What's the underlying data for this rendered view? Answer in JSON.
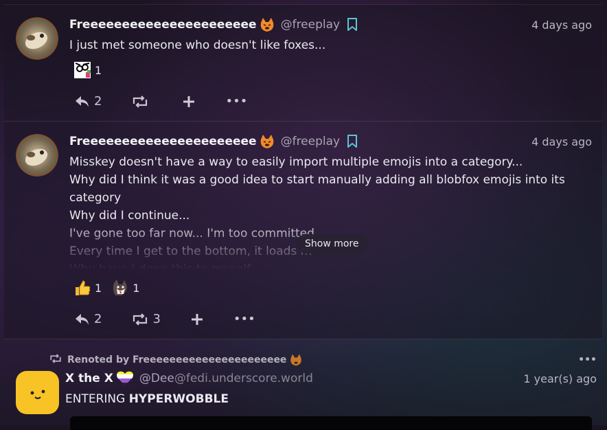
{
  "notes": [
    {
      "user": {
        "display_name": "Freeeeeeeeeeeeeeeeeeeeee",
        "name_emoji": "blobfox-angry-emoji",
        "handle": "@freeplay",
        "bookmark_icon": "bookmark-icon"
      },
      "time": "4 days ago",
      "text": [
        "I just met someone who doesn't like foxes..."
      ],
      "reactions": [
        {
          "emoji": "face-swirl-emoji",
          "count": "1"
        }
      ],
      "footer": {
        "reply_count": "2",
        "renote_count": "",
        "add_label": "+",
        "more_label": "•••"
      }
    },
    {
      "user": {
        "display_name": "Freeeeeeeeeeeeeeeeeeeeee",
        "name_emoji": "blobfox-angry-emoji",
        "handle": "@freeplay",
        "bookmark_icon": "bookmark-icon"
      },
      "time": "4 days ago",
      "text": [
        "Misskey doesn't have a way to easily import multiple emojis into a category...",
        "Why did I think it was a good idea to start manually adding all blobfox emojis into its category",
        "Why did I continue...",
        "I've gone too far now... I'm too committed",
        "Every time I get to the bottom, it loads m",
        "Why have I done this to myself"
      ],
      "show_more": "Show more",
      "reactions": [
        {
          "emoji": "thumbs-up-emoji",
          "count": "1"
        },
        {
          "emoji": "fox-head-emoji",
          "count": "1"
        }
      ],
      "footer": {
        "reply_count": "2",
        "renote_count": "3",
        "add_label": "+",
        "more_label": "•••"
      }
    }
  ],
  "renote": {
    "renoted_by_label": "Renoted by Freeeeeeeeeeeeeeeeeeeeee",
    "renoter_emoji": "blobfox-angry-emoji",
    "more_label": "•••",
    "user": {
      "display_name": "X the X",
      "flag_emoji": "nonbinary-heart-emoji",
      "handle": "@Dee",
      "host": "@fedi.underscore.world"
    },
    "time": "1 year(s) ago",
    "text_prefix": "ENTERING ",
    "text_bold": "HYPERWOBBLE"
  },
  "colors": {
    "accent": "#5bc6d6",
    "avatar_yellow": "#f7c325",
    "emoji_orange": "#f08a2a"
  }
}
